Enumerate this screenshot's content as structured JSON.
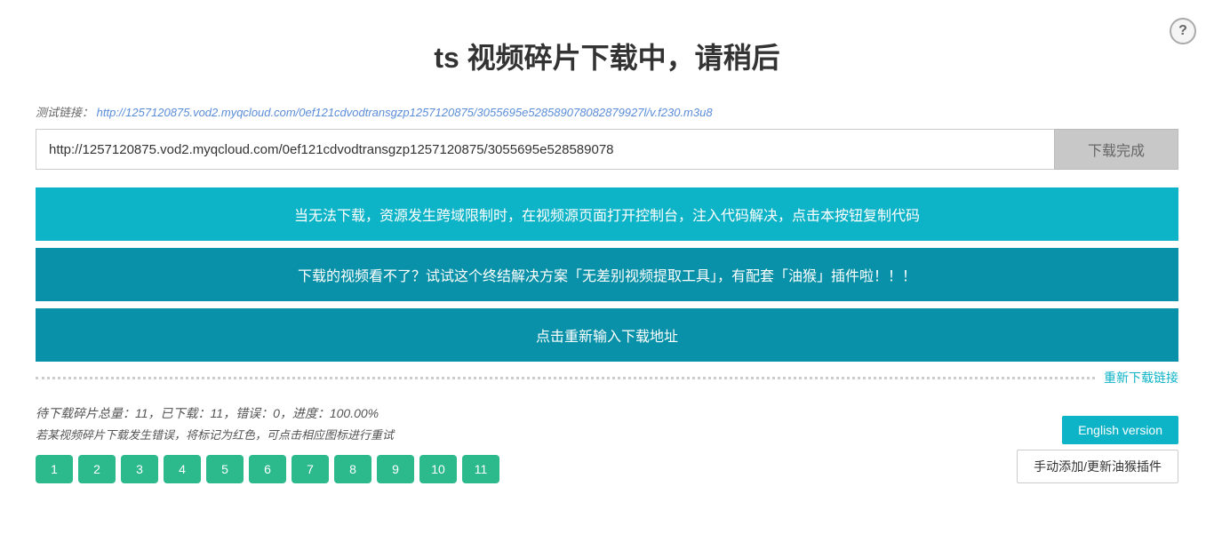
{
  "page": {
    "title": "ts 视频碎片下载中，请稍后",
    "help_label": "?",
    "test_link_label": "测试链接：",
    "test_link_url": "http://1257120875.vod2.myqcloud.com/0ef121cdvodtransgzp1257120875/3055695e528589078082879927l/v.f230.m3u8",
    "url_input_value": "http://1257120875.vod2.myqcloud.com/0ef121cdvodtransgzp1257120875/3055695e528589078",
    "download_complete_label": "下载完成",
    "btn1_label": "当无法下载，资源发生跨域限制时，在视频源页面打开控制台，注入代码解决，点击本按钮复制代码",
    "btn2_label": "下载的视频看不了？试试这个终结解决方案「无差别视频提取工具」，有配套「油猴」插件啦！！！",
    "btn3_label": "点击重新输入下载地址",
    "redownload_label": "重新下载链接",
    "stats_label": "待下载碎片总量：11，已下载：11，错误：0，进度：100.00%",
    "hint_label": "若某视频碎片下载发生错误，将标记为红色，可点击相应图标进行重试",
    "fragments": [
      {
        "id": 1,
        "label": "1"
      },
      {
        "id": 2,
        "label": "2"
      },
      {
        "id": 3,
        "label": "3"
      },
      {
        "id": 4,
        "label": "4"
      },
      {
        "id": 5,
        "label": "5"
      },
      {
        "id": 6,
        "label": "6"
      },
      {
        "id": 7,
        "label": "7"
      },
      {
        "id": 8,
        "label": "8"
      },
      {
        "id": 9,
        "label": "9"
      },
      {
        "id": 10,
        "label": "10"
      },
      {
        "id": 11,
        "label": "11"
      }
    ],
    "english_version_label": "English version",
    "install_plugin_label": "手动添加/更新油猴插件"
  }
}
